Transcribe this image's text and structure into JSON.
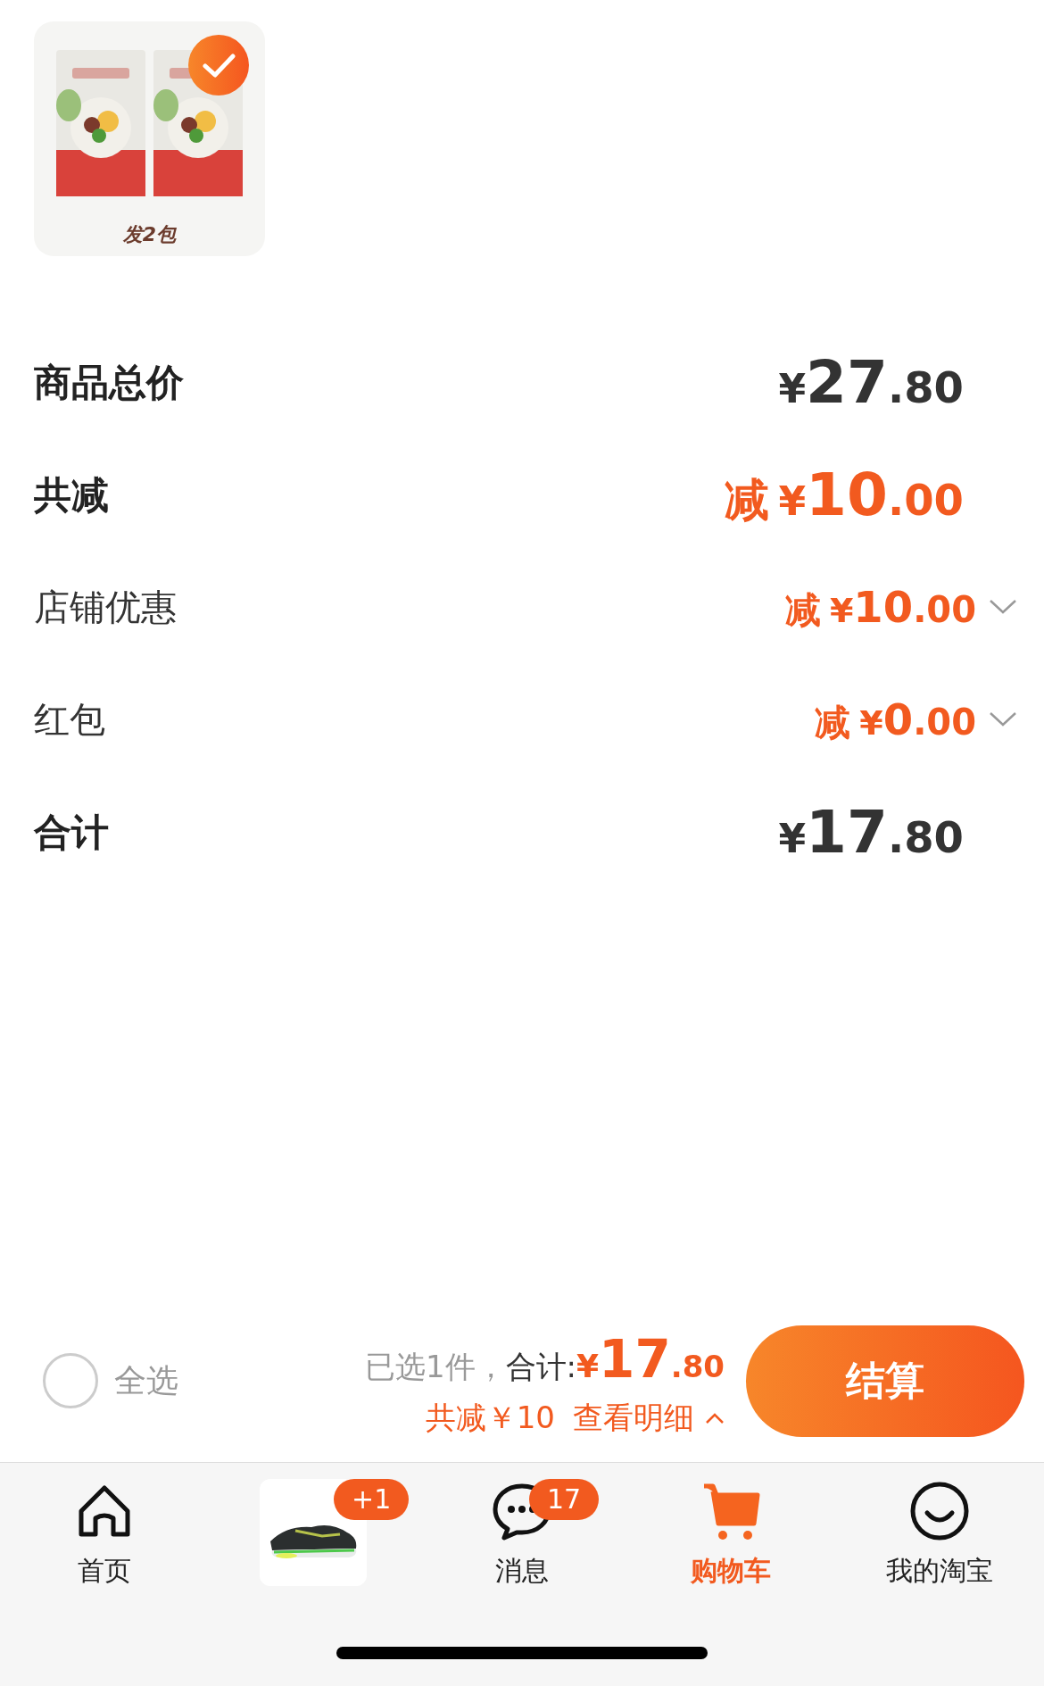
{
  "product": {
    "kind": "picture",
    "caption": "发2包",
    "checked": true
  },
  "summary_rows": [
    {
      "kind": "total",
      "label": "商品总价",
      "price": {
        "currency": "¥",
        "integer": "27",
        "decimal": ".80"
      }
    },
    {
      "kind": "discount",
      "label": "共减",
      "price": {
        "prefix": "减",
        "currency": "¥",
        "integer": "10",
        "decimal": ".00"
      }
    },
    {
      "kind": "adjustment",
      "label": "店铺优惠",
      "price": {
        "prefix": "减",
        "currency": "¥",
        "integer": "10",
        "decimal": ".00"
      }
    },
    {
      "kind": "adjustment",
      "label": "红包",
      "price": {
        "prefix": "减",
        "currency": "¥",
        "integer": "0",
        "decimal": ".00"
      }
    },
    {
      "kind": "total",
      "label": "合计",
      "price": {
        "currency": "¥",
        "integer": "17",
        "decimal": ".80"
      }
    }
  ],
  "checkout_bar": {
    "select_all": {
      "label": "全选",
      "checked": false
    },
    "selected_count": "已选1件，",
    "total_label": "合计:",
    "total": {
      "currency": "¥",
      "integer": "17",
      "decimal": ".80"
    },
    "discount": "共减￥10",
    "details_link": "查看明细",
    "button": "结算"
  },
  "tab_bar": [
    {
      "kind": "home",
      "label": "首页",
      "selected": false
    },
    {
      "kind": "thumbnail",
      "badge": "+1",
      "selected": false
    },
    {
      "kind": "messages",
      "label": "消息",
      "badge": "17",
      "selected": false
    },
    {
      "kind": "cart",
      "label": "购物车",
      "selected": true
    },
    {
      "kind": "profile",
      "label": "我的淘宝",
      "selected": false
    }
  ]
}
